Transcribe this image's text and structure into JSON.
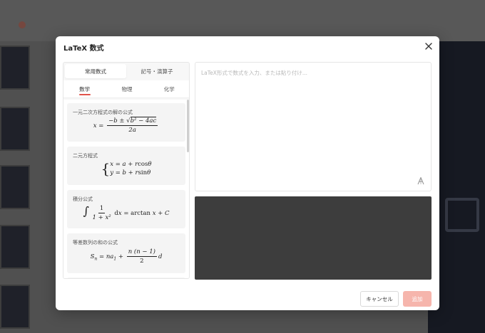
{
  "dialog": {
    "title": "LaTeX 数式",
    "cancel_label": "キャンセル",
    "add_label": "追加",
    "accent_color": "#e0524a",
    "add_button_color": "#f6b5ac"
  },
  "left_panel": {
    "segments": [
      "常用数式",
      "記号・演算子"
    ],
    "active_segment": "常用数式",
    "subtabs": [
      "数学",
      "物理",
      "化学"
    ],
    "active_subtab": "数学",
    "formulas": [
      {
        "label": "一元二次方程式の解の公式",
        "latex": "x=\\frac{-b\\pm\\sqrt{b^2-4ac}}{2a}"
      },
      {
        "label": "二元方程式",
        "latex": "\\begin{cases}x=a+r\\cos\\theta\\\\y=b+r\\sin\\theta\\end{cases}"
      },
      {
        "label": "積分公式",
        "latex": "\\int\\frac{1}{1+x^2}dx=\\arctan x+C"
      },
      {
        "label": "等差数列の和の公式",
        "latex": "S_n=na_1+\\frac{n(n-1)}{2}d"
      }
    ]
  },
  "editor": {
    "placeholder": "LaTeX形式で数式を入力、または貼り付け...",
    "value": ""
  },
  "icons": {
    "close": "close-icon",
    "font": "font-style-icon"
  }
}
